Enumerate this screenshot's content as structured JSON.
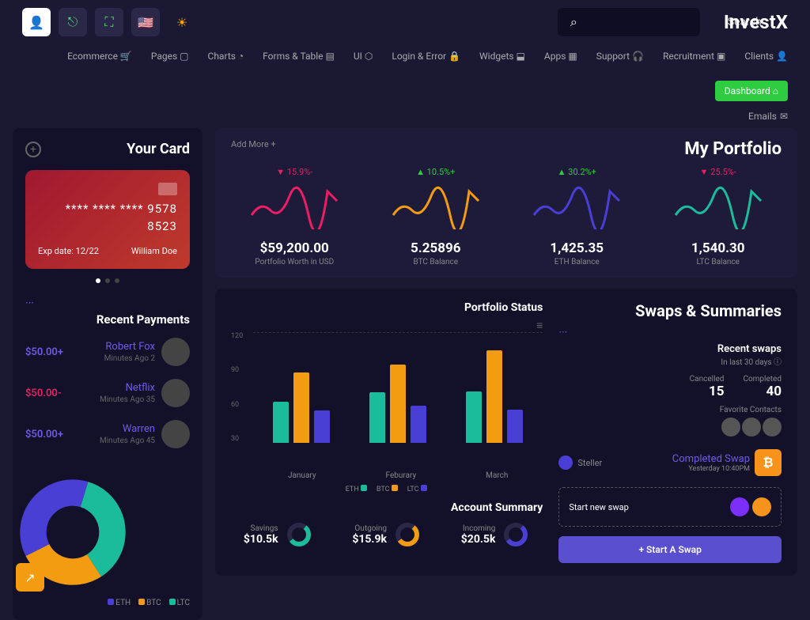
{
  "brand": "InvestX",
  "search": {
    "placeholder": "",
    "button": "Search"
  },
  "nav": [
    "Ecommerce",
    "Pages",
    "Charts",
    "Forms & Table",
    "UI",
    "Login & Error",
    "Widgets",
    "Apps",
    "Support",
    "Recruitment",
    "Clients"
  ],
  "nav_dash": "Dashboard",
  "subnav": "Emails",
  "sidebar": {
    "card_title": "Your Card",
    "cc": {
      "number": "**** **** **** 9578",
      "extra": "8523",
      "exp": "Exp date: 12/22",
      "name": "William Doe"
    },
    "payments_title": "Recent Payments",
    "payments": [
      {
        "amount": "$50.00+",
        "sign": "pos",
        "name": "Robert Fox",
        "time": "Minutes Ago 2"
      },
      {
        "amount": "$50.00-",
        "sign": "neg",
        "name": "Netflix",
        "time": "Minutes Ago 35"
      },
      {
        "amount": "$50.00+",
        "sign": "pos",
        "name": "Warren",
        "time": "Minutes Ago 45"
      }
    ],
    "legend": [
      "ETH",
      "BTC",
      "LTC"
    ]
  },
  "portfolio": {
    "add": "Add More +",
    "title": "My Portfolio",
    "items": [
      {
        "change": "▼ 15.9%-",
        "dir": "down",
        "color": "#e91e63",
        "value": "$59,200.00",
        "label": "Portfolio Worth in USD"
      },
      {
        "change": "▲ 10.5%+",
        "dir": "up",
        "color": "#f39c12",
        "value": "5.25896",
        "label": "BTC Balance"
      },
      {
        "change": "▲ 30.2%+",
        "dir": "up",
        "color": "#4a3fd4",
        "value": "1,425.35",
        "label": "ETH Balance"
      },
      {
        "change": "▼ 25.5%-",
        "dir": "down",
        "color": "#1abc9c",
        "value": "1,540.30",
        "label": "LTC Balance"
      }
    ]
  },
  "swaps": {
    "title": "Swaps & Summaries",
    "chart_title": "Portfolio Status",
    "recent": {
      "label": "Recent swaps",
      "sub": "In last 30 days ⓘ"
    },
    "stats": [
      {
        "label": "Cancelled",
        "val": "15"
      },
      {
        "label": "Completed",
        "val": "40"
      }
    ],
    "fav": "Favorite Contacts",
    "item": {
      "from": "Steller",
      "status": "Completed Swap",
      "time": "Yesterday 10:40PM",
      "sym": "₿"
    },
    "new_label": "Start new swap",
    "btn": "+ Start A Swap",
    "acct_title": "Account Summary",
    "accts": [
      {
        "label": "Savings",
        "val": "$10.5k",
        "color": "#1abc9c"
      },
      {
        "label": "Outgoing",
        "val": "$15.9k",
        "color": "#f39c12"
      },
      {
        "label": "Incoming",
        "val": "$20.5k",
        "color": "#4a3fd4"
      }
    ]
  },
  "chart_data": {
    "type": "bar",
    "categories": [
      "January",
      "Feburary",
      "March"
    ],
    "series": [
      {
        "name": "ETH",
        "color": "#1abc9c",
        "values": [
          45,
          55,
          56
        ]
      },
      {
        "name": "BTC",
        "color": "#f39c12",
        "values": [
          76,
          85,
          100
        ]
      },
      {
        "name": "LTC",
        "color": "#4a3fd4",
        "values": [
          35,
          40,
          36
        ]
      }
    ],
    "ylim": [
      0,
      120
    ],
    "yticks": [
      30,
      60,
      90,
      120
    ]
  }
}
